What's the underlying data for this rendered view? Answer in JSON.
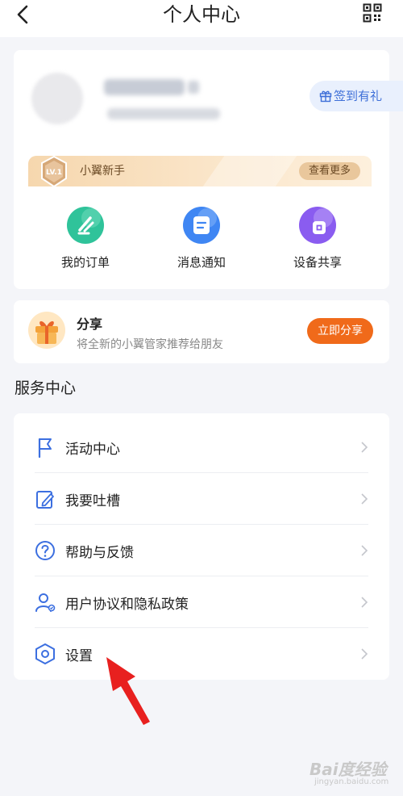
{
  "header": {
    "title": "个人中心"
  },
  "profile": {
    "checkin_label": "签到有礼",
    "level": {
      "badge": "LV.1",
      "name": "小翼新手",
      "more_label": "查看更多"
    },
    "shortcuts": [
      {
        "label": "我的订单",
        "icon": "order-icon",
        "color": "#2fc39a"
      },
      {
        "label": "消息通知",
        "icon": "message-icon",
        "color": "#3f86f3"
      },
      {
        "label": "设备共享",
        "icon": "device-share-icon",
        "color": "#8a5cf0"
      }
    ]
  },
  "share_card": {
    "title": "分享",
    "subtitle": "将全新的小翼管家推荐给朋友",
    "button_label": "立即分享"
  },
  "service": {
    "section_title": "服务中心",
    "items": [
      {
        "label": "活动中心",
        "icon": "flag-icon"
      },
      {
        "label": "我要吐槽",
        "icon": "edit-icon"
      },
      {
        "label": "帮助与反馈",
        "icon": "help-icon"
      },
      {
        "label": "用户协议和隐私政策",
        "icon": "user-policy-icon"
      },
      {
        "label": "设置",
        "icon": "settings-icon"
      }
    ]
  },
  "watermark": {
    "main": "Bai度经验",
    "sub": "jingyan.baidu.com"
  },
  "colors": {
    "accent_blue": "#3e6fd8",
    "share_orange": "#f06a1a",
    "level_gold": "#f6d7ae"
  }
}
